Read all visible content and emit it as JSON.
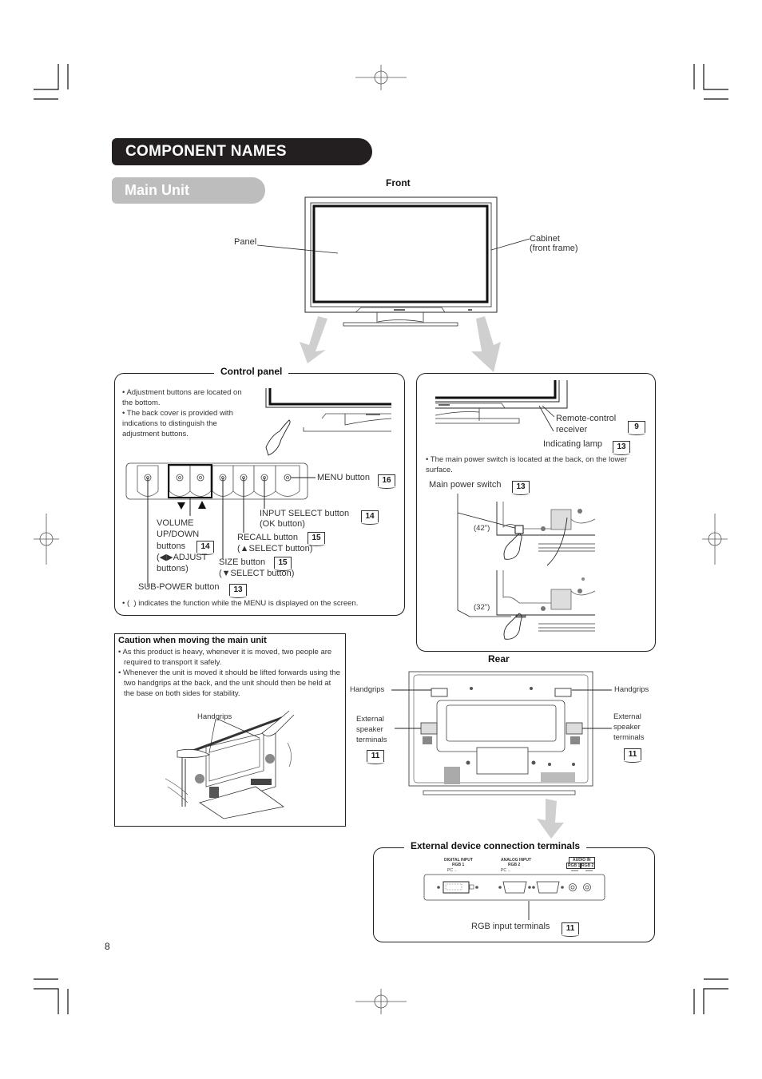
{
  "page": {
    "section_title": "COMPONENT NAMES",
    "subsection_title": "Main Unit",
    "page_number": "8"
  },
  "front": {
    "heading": "Front",
    "labels": {
      "panel": "Panel",
      "cabinet_line1": "Cabinet",
      "cabinet_line2": "(front frame)"
    }
  },
  "control_panel": {
    "heading": "Control panel",
    "notes": [
      "Adjustment buttons are located on the bottom.",
      "The back cover is provided with indications to distinguish the adjustment buttons."
    ],
    "buttons": [
      {
        "label": "MENU button",
        "ref": "16"
      },
      {
        "label_line1": "INPUT SELECT button",
        "label_line2": "(OK button)",
        "ref": "14"
      },
      {
        "label_line1": "RECALL button",
        "label_line2": "(▲SELECT button)",
        "ref": "15"
      },
      {
        "label_line1": "VOLUME",
        "label_line2": "UP/DOWN",
        "label_line3": "buttons",
        "label_line4": "(◀▶ADJUST",
        "label_line5": "buttons)",
        "ref": "14"
      },
      {
        "label_line1": "SIZE button",
        "label_line2": "(▼SELECT button)",
        "ref": "15"
      },
      {
        "label": "SUB-POWER button",
        "ref": "13"
      }
    ],
    "footnote": "(  ) indicates the function while the MENU is displayed on the screen."
  },
  "right_panel": {
    "remote_line1": "Remote-control",
    "remote_line2": "receiver",
    "remote_ref": "9",
    "lamp_label": "Indicating lamp",
    "lamp_ref": "13",
    "note": "The main power switch is located at the back, on the lower surface.",
    "switch_label": "Main power switch",
    "switch_ref": "13",
    "size_42": "(42\")",
    "size_32": "(32\")"
  },
  "caution": {
    "title": "Caution when moving the main unit",
    "items": [
      "As this product is heavy, whenever it is moved, two people are required to transport it safely.",
      "Whenever the unit is moved it should be lifted forwards using the two handgrips at the back, and the unit should then be held at the base on both sides for stability."
    ],
    "handgrips_label": "Handgrips"
  },
  "rear": {
    "heading": "Rear",
    "handgrips_left": "Handgrips",
    "handgrips_right": "Handgrips",
    "speaker_left": [
      "External",
      "speaker",
      "terminals"
    ],
    "speaker_right": [
      "External",
      "speaker",
      "terminals"
    ],
    "speaker_ref_left": "11",
    "speaker_ref_right": "11"
  },
  "terminals": {
    "heading": "External device connection terminals",
    "digital_line1": "DIGITAL INPUT",
    "digital_line2": "RGB 1",
    "digital_pc": "PC ←",
    "analog_line1": "ANALOG INPUT",
    "analog_line2": "RGB 2",
    "analog_pc": "PC ←",
    "audio_title": "AUDIO IN",
    "audio_rgb1": "RGB 1",
    "audio_rgb2": "RGB 2",
    "rgb_label": "RGB input terminals",
    "rgb_ref": "11"
  }
}
